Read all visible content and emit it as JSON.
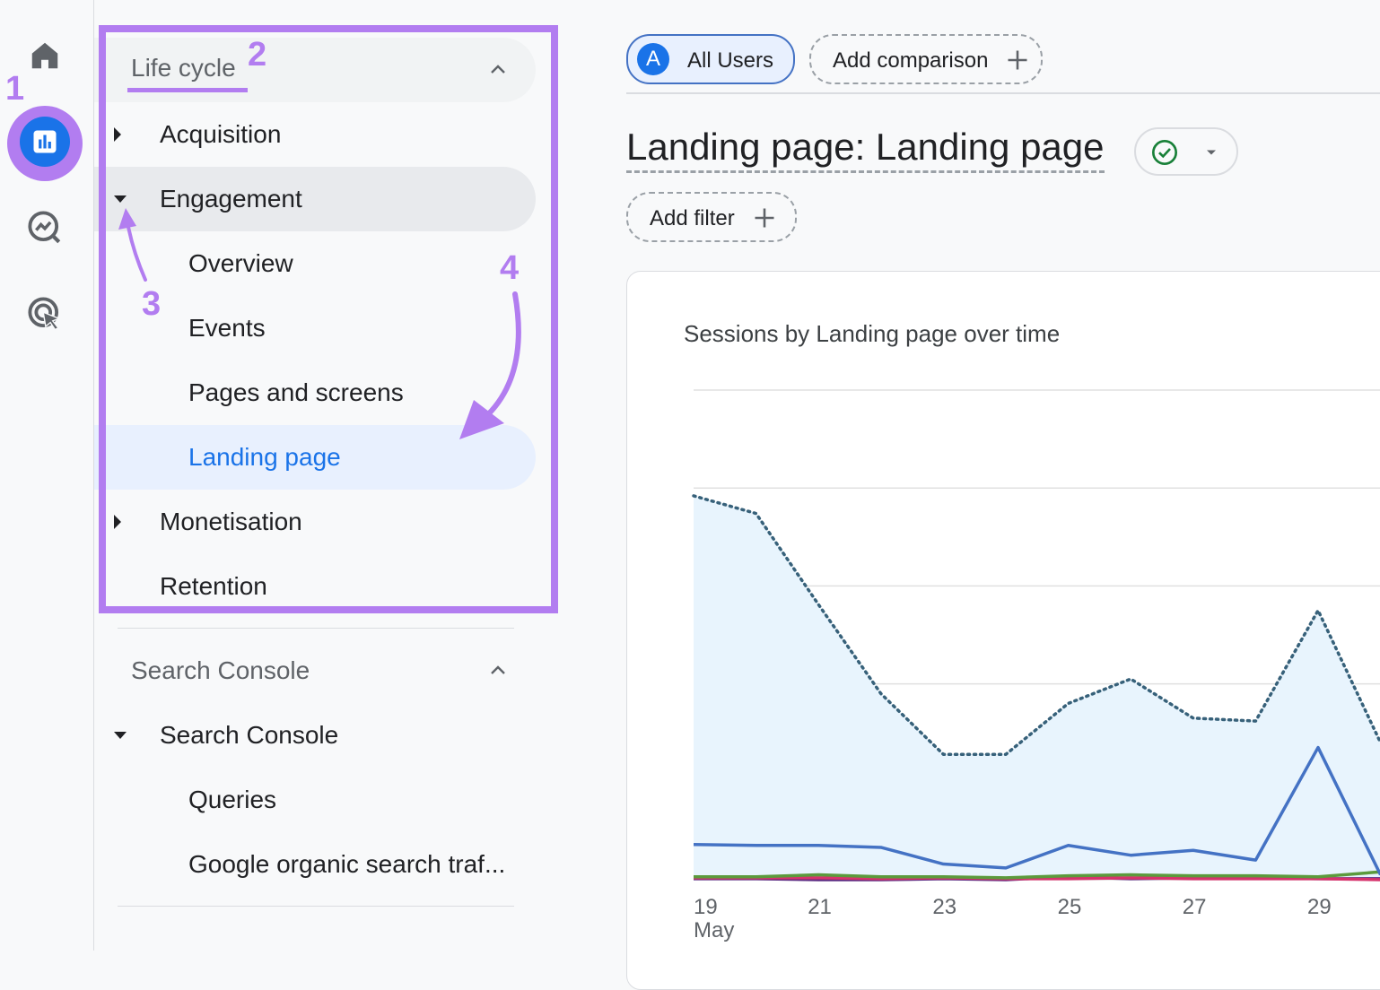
{
  "rail": {
    "items": [
      "home-icon",
      "reports-icon",
      "explore-icon",
      "advertising-icon"
    ]
  },
  "sidebar": {
    "lifecycle": {
      "title": "Life cycle",
      "items": [
        {
          "label": "Acquisition"
        },
        {
          "label": "Engagement"
        },
        {
          "label": "Overview"
        },
        {
          "label": "Events"
        },
        {
          "label": "Pages and screens"
        },
        {
          "label": "Landing page"
        },
        {
          "label": "Monetisation"
        },
        {
          "label": "Retention"
        }
      ]
    },
    "search_console": {
      "title": "Search Console",
      "items": [
        {
          "label": "Search Console"
        },
        {
          "label": "Queries"
        },
        {
          "label": "Google organic search traf..."
        }
      ]
    }
  },
  "annotations": {
    "n1": "1",
    "n2": "2",
    "n3": "3",
    "n4": "4"
  },
  "header": {
    "segment_avatar": "A",
    "segment_label": "All Users",
    "add_comparison": "Add comparison",
    "page_title": "Landing page: Landing page",
    "add_filter": "Add filter"
  },
  "colors": {
    "accent": "#1a73e8",
    "annotation": "#b27df0",
    "line_primary": "#4472c4",
    "line_dotted": "#37617a",
    "area_fill": "#e8f4fd"
  },
  "chart_data": {
    "type": "line",
    "title": "Sessions by Landing page over time",
    "categories": [
      "19",
      "20",
      "21",
      "22",
      "23",
      "24",
      "25",
      "26",
      "27",
      "28",
      "29",
      "30"
    ],
    "x_tick_labels": [
      "19",
      "21",
      "23",
      "25",
      "27",
      "29"
    ],
    "x_sub_label": "May",
    "ylim": [
      0,
      5
    ],
    "series": [
      {
        "style": "dotted",
        "color": "#37617a",
        "values": [
          3.92,
          3.74,
          2.81,
          1.9,
          1.28,
          1.28,
          1.8,
          2.05,
          1.65,
          1.62,
          2.75,
          1.4
        ]
      },
      {
        "style": "solid",
        "color": "#4472c4",
        "values": [
          0.36,
          0.35,
          0.35,
          0.33,
          0.16,
          0.12,
          0.35,
          0.25,
          0.3,
          0.2,
          1.35,
          0.05
        ]
      },
      {
        "style": "solid",
        "color": "#5b9a3c",
        "values": [
          0.03,
          0.03,
          0.05,
          0.03,
          0.03,
          0.02,
          0.04,
          0.05,
          0.04,
          0.04,
          0.03,
          0.08
        ]
      },
      {
        "style": "solid",
        "color": "#d6336c",
        "values": [
          0.02,
          0.02,
          0.02,
          0.01,
          0.02,
          0.01,
          0.01,
          0.02,
          0.01,
          0.01,
          0.01,
          0.0
        ]
      },
      {
        "style": "solid",
        "color": "#5b2b82",
        "values": [
          0.01,
          0.01,
          0.0,
          0.0,
          0.01,
          0.0,
          0.03,
          0.01,
          0.02,
          0.02,
          0.01,
          0.01
        ]
      }
    ]
  }
}
